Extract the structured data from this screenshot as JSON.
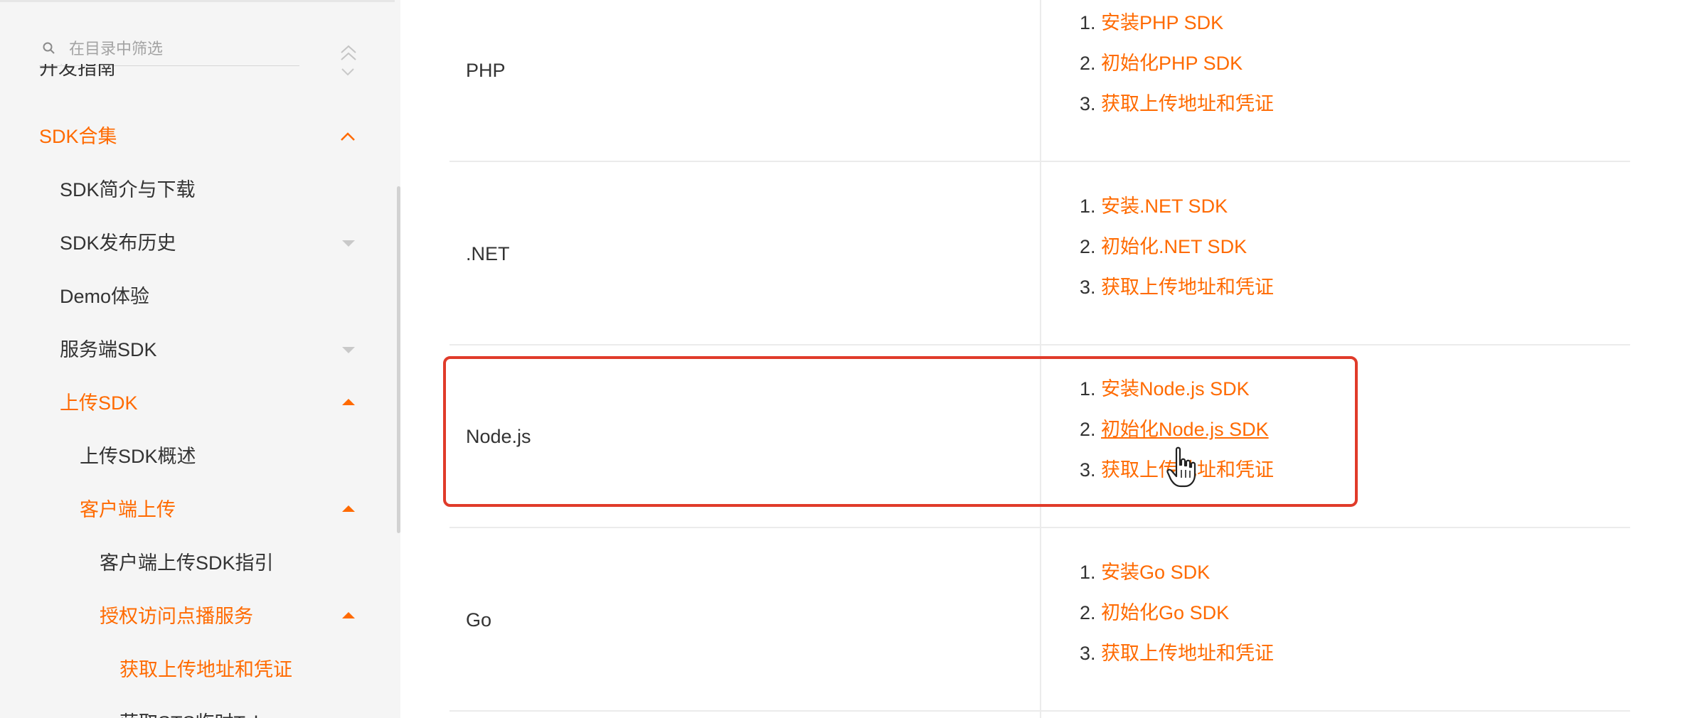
{
  "sidebar": {
    "search": {
      "placeholder": "在目录中筛选"
    },
    "items": [
      {
        "label": "开发指南",
        "state": "collapsed"
      },
      {
        "label": "SDK合集",
        "state": "expanded",
        "active": true
      },
      {
        "label": "SDK简介与下载"
      },
      {
        "label": "SDK发布历史",
        "state": "collapsed"
      },
      {
        "label": "Demo体验"
      },
      {
        "label": "服务端SDK",
        "state": "collapsed"
      },
      {
        "label": "上传SDK",
        "state": "expanded",
        "active": true
      },
      {
        "label": "上传SDK概述"
      },
      {
        "label": "客户端上传",
        "state": "expanded",
        "active": true
      },
      {
        "label": "客户端上传SDK指引"
      },
      {
        "label": "授权访问点播服务",
        "state": "expanded",
        "active": true
      },
      {
        "label": "获取上传地址和凭证",
        "active": true
      },
      {
        "label": "获取STS临时Token"
      }
    ]
  },
  "table": {
    "rows": [
      {
        "language": "PHP",
        "steps": [
          {
            "num": "1.",
            "text": "安装PHP SDK"
          },
          {
            "num": "2.",
            "text": "初始化PHP SDK"
          },
          {
            "num": "3.",
            "text": "获取上传地址和凭证"
          }
        ]
      },
      {
        "language": ".NET",
        "steps": [
          {
            "num": "1.",
            "text": "安装.NET SDK"
          },
          {
            "num": "2.",
            "text": "初始化.NET SDK"
          },
          {
            "num": "3.",
            "text": "获取上传地址和凭证"
          }
        ]
      },
      {
        "language": "Node.js",
        "highlighted": true,
        "steps": [
          {
            "num": "1.",
            "text": "安装Node.js SDK"
          },
          {
            "num": "2.",
            "text": "初始化Node.js SDK",
            "hovered": true
          },
          {
            "num": "3.",
            "text": "获取上传地址和凭证"
          }
        ]
      },
      {
        "language": "Go",
        "steps": [
          {
            "num": "1.",
            "text": "安装Go SDK"
          },
          {
            "num": "2.",
            "text": "初始化Go SDK"
          },
          {
            "num": "3.",
            "text": "获取上传地址和凭证"
          }
        ]
      }
    ]
  },
  "colors": {
    "accent": "#ff6a00",
    "highlight_border": "#e03b2a",
    "text": "#333333",
    "sidebar_bg": "#f5f5f5"
  },
  "icons": {
    "search": "search-icon",
    "collapse_all": "collapse-all-icon",
    "chevron_down": "chevron-down-icon",
    "chevron_up": "chevron-up-icon",
    "caret_down": "caret-down-icon",
    "caret_up": "caret-up-icon",
    "cursor": "hand-cursor-icon"
  }
}
